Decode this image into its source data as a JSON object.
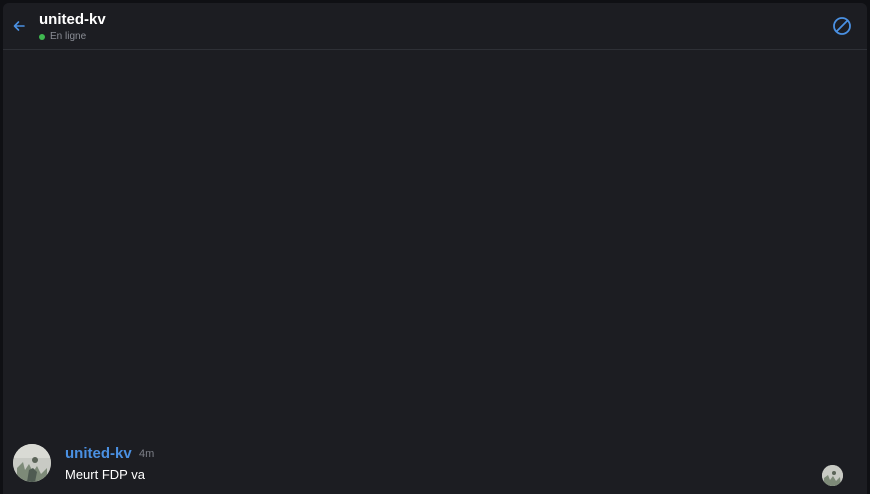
{
  "header": {
    "title": "united-kv",
    "status": "En ligne",
    "back_icon": "arrow-left-icon",
    "block_icon": "block-icon",
    "accent_color": "#4a90e2",
    "status_color": "#3fb950"
  },
  "messages": [
    {
      "author": "united-kv",
      "time": "4m",
      "text": "Meurt FDP va"
    }
  ]
}
